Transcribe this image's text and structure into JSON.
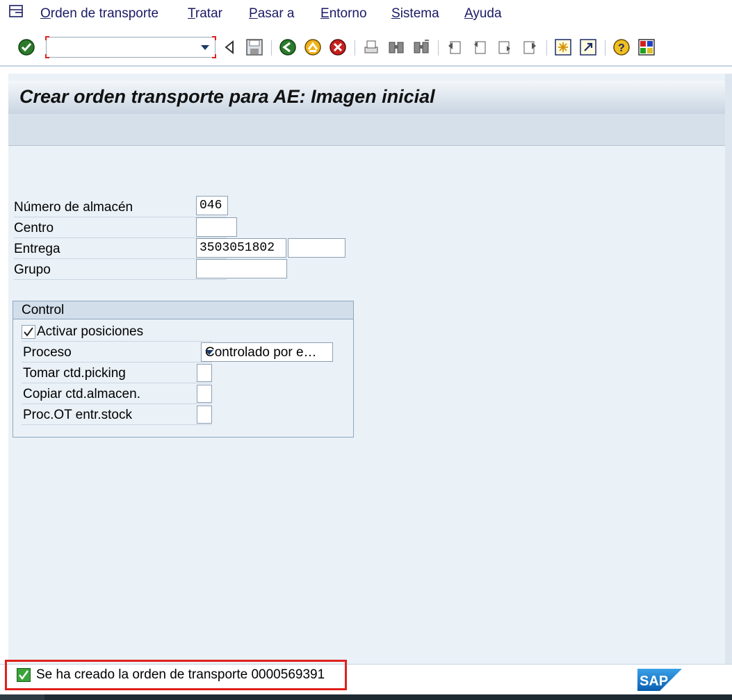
{
  "menu": {
    "items": [
      {
        "accel": "O",
        "rest": "rden de transporte"
      },
      {
        "accel": "T",
        "rest": "ratar"
      },
      {
        "accel": "P",
        "rest": "asar a"
      },
      {
        "accel": "E",
        "rest": "ntorno"
      },
      {
        "accel": "S",
        "rest": "istema"
      },
      {
        "accel": "A",
        "rest": "yuda"
      }
    ]
  },
  "toolbar": {
    "command_value": "",
    "icons": [
      "enter-icon",
      "back-arrow-icon",
      "save-icon",
      "back-green-icon",
      "exit-icon",
      "cancel-icon",
      "print-icon",
      "find-icon",
      "find-next-icon",
      "first-page-icon",
      "previous-page-icon",
      "next-page-icon",
      "last-page-icon",
      "create-session-icon",
      "shortcut-icon",
      "help-icon",
      "layout-icon"
    ]
  },
  "screen": {
    "title": "Crear orden transporte para AE: Imagen inicial"
  },
  "fields": {
    "almacen_label": "Número de almacén",
    "almacen_value": "046",
    "centro_label": "Centro",
    "centro_value": "",
    "entrega_label": "Entrega",
    "entrega_value": "3503051802",
    "entrega_value2": "",
    "grupo_label": "Grupo",
    "grupo_value": ""
  },
  "control": {
    "title": "Control",
    "activar_label": "Activar posiciones",
    "activar_checked": true,
    "proceso_label": "Proceso",
    "proceso_value": "Controlado por e…",
    "tomar_label": "Tomar ctd.picking",
    "copiar_label": "Copiar ctd.almacen.",
    "proc_label": "Proc.OT entr.stock"
  },
  "status": {
    "message": "Se ha creado la orden de transporte 0000569391",
    "type": "success"
  },
  "brand": {
    "logo": "SAP",
    "accent": "#1a1a66",
    "highlight": "#e0201c"
  }
}
